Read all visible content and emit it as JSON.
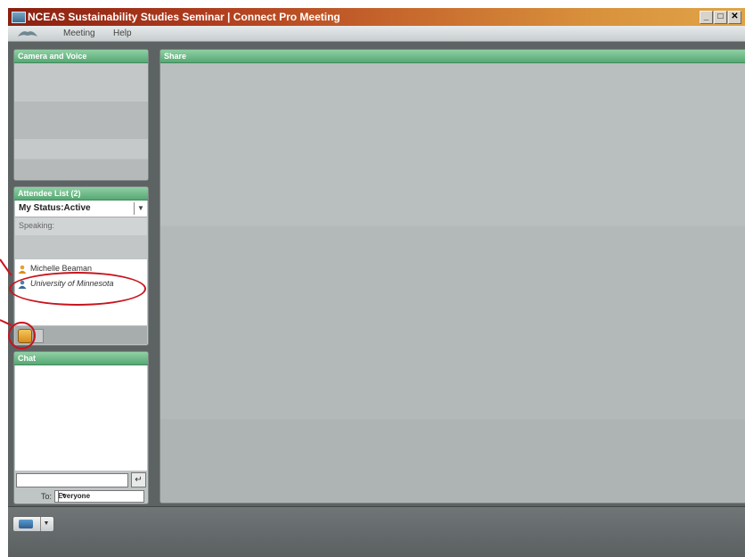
{
  "window": {
    "title": "NCEAS Sustainability Studies Seminar | Connect Pro Meeting",
    "controls": [
      "_",
      "□",
      "✕"
    ]
  },
  "menubar": {
    "logo_icon": "adobe-connect-logo-icon",
    "items": [
      "Meeting",
      "Help"
    ]
  },
  "camera_pod": {
    "title": "Camera and Voice"
  },
  "attendee_pod": {
    "title": "Attendee List (2)",
    "status_label": "My Status:Active",
    "speaking_label": "Speaking:",
    "attendees": [
      {
        "name": "Michelle Beaman",
        "role_icon": "host-user-icon"
      },
      {
        "name": "University of Minnesota",
        "role_icon": "participant-user-icon"
      }
    ]
  },
  "chat_pod": {
    "title": "Chat",
    "to_label": "To:",
    "to_value": "Everyone",
    "send_icon": "enter-icon"
  },
  "share_pod": {
    "title": "Share"
  },
  "colors": {
    "pod_header": "#57a874",
    "annotation": "#c8141c",
    "titlebar_start": "#8a1f10",
    "titlebar_end": "#e0a448"
  }
}
